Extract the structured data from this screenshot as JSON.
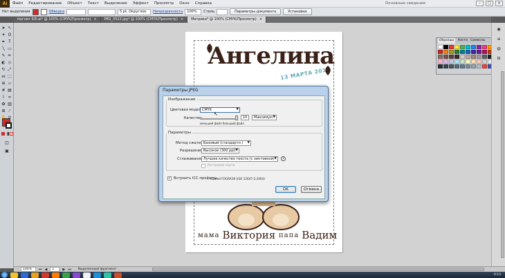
{
  "app": {
    "logo": "Ai",
    "menu": [
      "Файл",
      "Редактирование",
      "Объект",
      "Текст",
      "Выделение",
      "Эффект",
      "Просмотр",
      "Окно",
      "Справка"
    ],
    "workspace": "Основные сведения"
  },
  "control_bar": {
    "selection_label": "Нет выделения",
    "stroke_label": "Обводка",
    "brush_value": "5 pt. Округлое",
    "opacity_label": "Непрозрачность",
    "opacity_value": "100%",
    "style_label": "Стиль",
    "doc_settings_button": "Параметры документа",
    "preferences_button": "Установки",
    "fill_color": "#d12a2a"
  },
  "tabs": [
    {
      "label": "магнит 6/6.ai* @ 100% (CMYK/Просмотр)",
      "active": false
    },
    {
      "label": "IMG_3522.jpg* @ 100% (CMYK/Просмотр)",
      "active": false
    },
    {
      "label": "Метрика* @ 100% (CMYK/Просмотр)",
      "active": true
    }
  ],
  "artboard": {
    "name": "Ангелина",
    "date": "13 МАРТА 2015",
    "mother_label": "мама",
    "mother_name": "Виктория",
    "father_label": "папа",
    "father_name": "Вадим",
    "text_color": "#3b2218",
    "accent_color": "#5fa8b3"
  },
  "swatches_panel": {
    "tabs": [
      "Образцы",
      "Кисти",
      "Символы"
    ],
    "colors": [
      "#ffffff",
      "#000000",
      "#e53935",
      "#ffeb3b",
      "#4caf50",
      "#00bcd4",
      "#1e88e5",
      "#8e24aa",
      "#ec407a",
      "#ff9800",
      "#c62828",
      "#f57f17",
      "#9e9d24",
      "#2e7d32",
      "#00838f",
      "#1565c0",
      "#4527a0",
      "#6a1b9a",
      "#ad1457",
      "#bf360c",
      "#8d6e63",
      "#795548",
      "#5d4037",
      "#3e2723",
      "#d7ccc8",
      "#bcaaa4",
      "#a1887f",
      "#9e9e9e",
      "#616161",
      "#212121",
      "#f8bbd0",
      "#e1bee7",
      "#c5cae9",
      "#b3e5fc",
      "#c8e6c9",
      "#fff9c4",
      "#ffe0b2",
      "#ffccbc",
      "#cfd8dc",
      "#eceff1",
      "#263238",
      "#37474f",
      "#455a64",
      "#546e7a",
      "#607d8b",
      "#78909c",
      "#90a4ae",
      "#b0bec5",
      "#f44336",
      "#3f51b5"
    ]
  },
  "dialog": {
    "title": "Параметры JPEG",
    "image_group": "Изображение",
    "color_model_label": "Цветовая модель:",
    "color_model_value": "CMYK",
    "quality_label": "Качество:",
    "quality_value": "10",
    "quality_preset": "Максимум",
    "quality_hint": "меньший файл  больший файл",
    "params_group": "Параметры",
    "compression_label": "Метод сжатия:",
    "compression_value": "Базовый (стандартн.)",
    "resolution_label": "Разрешение:",
    "resolution_value": "Высокое (300 ppi)",
    "antialias_label": "Сглаживание:",
    "antialias_value": "Лучшее качество текста (с хинтовкой)",
    "imagemap_label": "Растровая карта",
    "icc_label": "Встроить ICC-профиль:",
    "icc_value": "Coated FOGRA39 (ISO 12647-2:2004)",
    "icc_checked": true,
    "ok_button": "OK",
    "cancel_button": "Отмена"
  },
  "status_bar": {
    "zoom": "100%",
    "page": "1",
    "mode": "Выделенный фрагмент"
  },
  "taskbar": {
    "clock": "0:13",
    "icon_colors": [
      "#f4c430",
      "#2d6bd1",
      "#e8a020",
      "#d33a2c",
      "#ff7b00",
      "#3aa04a",
      "#8a4ad0",
      "#f0f0f0",
      "#1f8fd8",
      "#2ec5a5",
      "#c94f2a"
    ]
  }
}
